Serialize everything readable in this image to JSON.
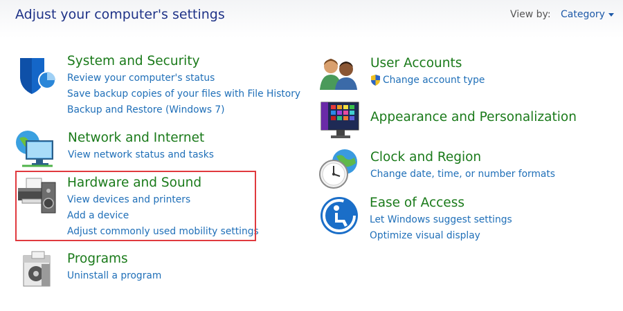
{
  "header": {
    "title": "Adjust your computer's settings",
    "view_by_label": "View by:",
    "view_by_value": "Category"
  },
  "categories_left": [
    {
      "title": "System and Security",
      "icon": "shield-icon",
      "links": [
        "Review your computer's status",
        "Save backup copies of your files with File History",
        "Backup and Restore (Windows 7)"
      ]
    },
    {
      "title": "Network and Internet",
      "icon": "network-globe-icon",
      "links": [
        "View network status and tasks"
      ]
    },
    {
      "title": "Hardware and Sound",
      "icon": "printer-speaker-icon",
      "links": [
        "View devices and printers",
        "Add a device",
        "Adjust commonly used mobility settings"
      ]
    },
    {
      "title": "Programs",
      "icon": "programs-box-icon",
      "links": [
        "Uninstall a program"
      ]
    }
  ],
  "categories_right": [
    {
      "title": "User Accounts",
      "icon": "users-icon",
      "links": [
        "Change account type"
      ]
    },
    {
      "title": "Appearance and Personalization",
      "icon": "monitor-palette-icon",
      "links": []
    },
    {
      "title": "Clock and Region",
      "icon": "clock-globe-icon",
      "links": [
        "Change date, time, or number formats"
      ]
    },
    {
      "title": "Ease of Access",
      "icon": "ease-of-access-icon",
      "links": [
        "Let Windows suggest settings",
        "Optimize visual display"
      ]
    }
  ],
  "colors": {
    "title_green": "#1a7a1a",
    "link_blue": "#1f6fb8",
    "highlight_red": "#e0393e"
  }
}
